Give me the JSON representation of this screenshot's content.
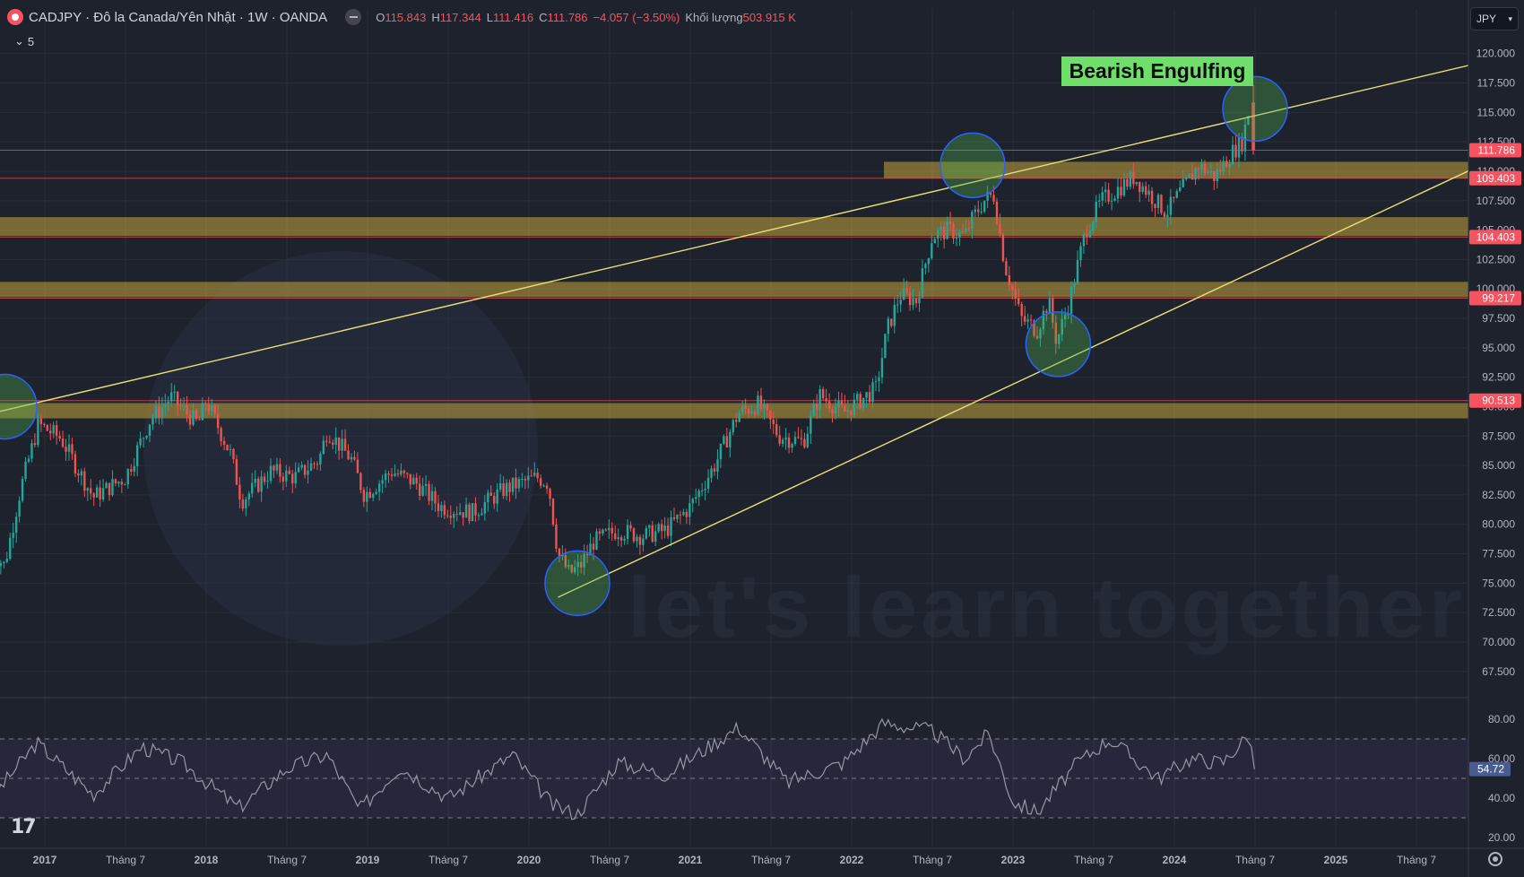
{
  "header": {
    "symbol": "CADJPY · Đô la Canada/Yên Nhật · 1W · OANDA",
    "ohlc": [
      {
        "k": "O",
        "v": "115.843"
      },
      {
        "k": "H",
        "v": "117.344"
      },
      {
        "k": "L",
        "v": "111.416"
      },
      {
        "k": "C",
        "v": "111.786"
      },
      {
        "k": "",
        "v": "−4.057 (−3.50%)"
      },
      {
        "k": "Khối lượng",
        "v": "503.915 K"
      }
    ]
  },
  "collapse_label": "5",
  "currency_button": "JPY",
  "tv_logo": "17",
  "colors": {
    "background": "#1e222d",
    "up": "#26a69a",
    "down": "#ef5350",
    "zone": "#c2a43d",
    "trendline": "#e8e17a",
    "annotation": "#6ee06a",
    "circle_fill": "#4caf50",
    "circle_stroke": "#2962ff",
    "price_label": "#f7525f",
    "rsi_label": "#4a5b8f",
    "rsi_line": "#9598a1"
  },
  "chart_data": {
    "type": "candlestick",
    "timeframe": "1W",
    "watermark": "let's learn together",
    "y_axis": {
      "range": [
        65.5,
        121.5
      ],
      "ticks": [
        "120.000",
        "117.500",
        "115.000",
        "112.500",
        "110.000",
        "107.500",
        "105.000",
        "102.500",
        "100.000",
        "97.500",
        "95.000",
        "92.500",
        "90.000",
        "87.500",
        "85.000",
        "82.500",
        "80.000",
        "77.500",
        "75.000",
        "72.500",
        "70.000",
        "67.500"
      ]
    },
    "x_axis": {
      "labels": [
        "2017",
        "Tháng 7",
        "2018",
        "Tháng 7",
        "2019",
        "Tháng 7",
        "2020",
        "Tháng 7",
        "2021",
        "Tháng 7",
        "2022",
        "Tháng 7",
        "2023",
        "Tháng 7",
        "2024",
        "Tháng 7",
        "2025",
        "Tháng 7"
      ],
      "bold": [
        true,
        false,
        true,
        false,
        true,
        false,
        true,
        false,
        true,
        false,
        true,
        false,
        true,
        false,
        true,
        false,
        true,
        false
      ]
    },
    "anchors": [
      {
        "t": 2016.65,
        "p": 78.0
      },
      {
        "t": 2016.75,
        "p": 76.5
      },
      {
        "t": 2016.85,
        "p": 83.0
      },
      {
        "t": 2016.96,
        "p": 88.5
      },
      {
        "t": 2017.1,
        "p": 87.3
      },
      {
        "t": 2017.3,
        "p": 82.3
      },
      {
        "t": 2017.5,
        "p": 84.0
      },
      {
        "t": 2017.65,
        "p": 88.8
      },
      {
        "t": 2017.78,
        "p": 90.8
      },
      {
        "t": 2017.95,
        "p": 88.5
      },
      {
        "t": 2018.0,
        "p": 90.5
      },
      {
        "t": 2018.15,
        "p": 86.0
      },
      {
        "t": 2018.22,
        "p": 82.0
      },
      {
        "t": 2018.4,
        "p": 84.5
      },
      {
        "t": 2018.55,
        "p": 84.0
      },
      {
        "t": 2018.7,
        "p": 85.5
      },
      {
        "t": 2018.75,
        "p": 88.0
      },
      {
        "t": 2018.9,
        "p": 85.5
      },
      {
        "t": 2018.98,
        "p": 82.5
      },
      {
        "t": 2019.15,
        "p": 84.5
      },
      {
        "t": 2019.3,
        "p": 83.5
      },
      {
        "t": 2019.45,
        "p": 81.5
      },
      {
        "t": 2019.65,
        "p": 81.0
      },
      {
        "t": 2019.85,
        "p": 83.0
      },
      {
        "t": 2020.05,
        "p": 84.0
      },
      {
        "t": 2020.12,
        "p": 83.5
      },
      {
        "t": 2020.18,
        "p": 77.5
      },
      {
        "t": 2020.25,
        "p": 75.8
      },
      {
        "t": 2020.32,
        "p": 76.5
      },
      {
        "t": 2020.4,
        "p": 78.5
      },
      {
        "t": 2020.55,
        "p": 79.5
      },
      {
        "t": 2020.7,
        "p": 79.0
      },
      {
        "t": 2020.85,
        "p": 79.5
      },
      {
        "t": 2021.0,
        "p": 81.5
      },
      {
        "t": 2021.15,
        "p": 85.0
      },
      {
        "t": 2021.3,
        "p": 89.5
      },
      {
        "t": 2021.42,
        "p": 90.2
      },
      {
        "t": 2021.55,
        "p": 87.5
      },
      {
        "t": 2021.7,
        "p": 87.0
      },
      {
        "t": 2021.8,
        "p": 91.0
      },
      {
        "t": 2021.95,
        "p": 89.5
      },
      {
        "t": 2022.05,
        "p": 90.5
      },
      {
        "t": 2022.15,
        "p": 91.5
      },
      {
        "t": 2022.22,
        "p": 96.5
      },
      {
        "t": 2022.3,
        "p": 99.5
      },
      {
        "t": 2022.4,
        "p": 99.0
      },
      {
        "t": 2022.5,
        "p": 104.5
      },
      {
        "t": 2022.6,
        "p": 105.0
      },
      {
        "t": 2022.7,
        "p": 104.5
      },
      {
        "t": 2022.75,
        "p": 106.0
      },
      {
        "t": 2022.82,
        "p": 107.5
      },
      {
        "t": 2022.88,
        "p": 108.0
      },
      {
        "t": 2022.95,
        "p": 102.0
      },
      {
        "t": 2023.05,
        "p": 97.5
      },
      {
        "t": 2023.15,
        "p": 96.5
      },
      {
        "t": 2023.22,
        "p": 99.0
      },
      {
        "t": 2023.27,
        "p": 95.5
      },
      {
        "t": 2023.35,
        "p": 99.0
      },
      {
        "t": 2023.45,
        "p": 105.0
      },
      {
        "t": 2023.55,
        "p": 107.5
      },
      {
        "t": 2023.65,
        "p": 108.5
      },
      {
        "t": 2023.75,
        "p": 109.5
      },
      {
        "t": 2023.85,
        "p": 108.0
      },
      {
        "t": 2023.95,
        "p": 106.5
      },
      {
        "t": 2024.05,
        "p": 108.5
      },
      {
        "t": 2024.15,
        "p": 110.5
      },
      {
        "t": 2024.25,
        "p": 109.5
      },
      {
        "t": 2024.35,
        "p": 111.5
      },
      {
        "t": 2024.42,
        "p": 112.5
      },
      {
        "t": 2024.47,
        "p": 115.8
      }
    ],
    "last_candle": {
      "open": 115.843,
      "high": 117.344,
      "low": 111.416,
      "close": 111.786
    },
    "zones": [
      {
        "low": 89.0,
        "high": 90.3,
        "from": 2016.6,
        "to": 2026.15
      },
      {
        "low": 99.3,
        "high": 100.6,
        "from": 2016.6,
        "to": 2026.0
      },
      {
        "low": 104.5,
        "high": 106.1,
        "from": 2016.6,
        "to": 2026.0
      },
      {
        "low": 109.4,
        "high": 110.8,
        "from": 2022.2,
        "to": 2025.95
      }
    ],
    "lines": [
      {
        "name": "upper-trendline",
        "points": [
          [
            2016.6,
            89.2
          ],
          [
            2025.95,
            119.4
          ]
        ]
      },
      {
        "name": "lower-trendline",
        "points": [
          [
            2020.18,
            73.8
          ],
          [
            2025.85,
            110.2
          ]
        ]
      }
    ],
    "circles": [
      {
        "t": 2016.75,
        "p": 90.0
      },
      {
        "t": 2020.3,
        "p": 75.0
      },
      {
        "t": 2022.75,
        "p": 110.5
      },
      {
        "t": 2023.28,
        "p": 95.3
      },
      {
        "t": 2024.5,
        "p": 115.3
      }
    ],
    "price_labels": [
      {
        "value": "111.786",
        "p": 111.786
      },
      {
        "value": "109.403",
        "p": 109.403
      },
      {
        "value": "104.403",
        "p": 104.403
      },
      {
        "value": "99.217",
        "p": 99.217
      },
      {
        "value": "90.513",
        "p": 90.513
      }
    ],
    "annotations": [
      "Bearish Engulfing"
    ],
    "rsi": {
      "range": [
        15,
        90
      ],
      "ticks": [
        "80.00",
        "60.00",
        "40.00",
        "20.00"
      ],
      "band": [
        30,
        70
      ],
      "mid": 50,
      "last": "54.72",
      "anchors": [
        {
          "t": 2016.65,
          "v": 38
        },
        {
          "t": 2016.95,
          "v": 68
        },
        {
          "t": 2017.3,
          "v": 42
        },
        {
          "t": 2017.6,
          "v": 66
        },
        {
          "t": 2017.85,
          "v": 58
        },
        {
          "t": 2018.2,
          "v": 35
        },
        {
          "t": 2018.5,
          "v": 55
        },
        {
          "t": 2018.75,
          "v": 62
        },
        {
          "t": 2018.95,
          "v": 34
        },
        {
          "t": 2019.2,
          "v": 56
        },
        {
          "t": 2019.5,
          "v": 40
        },
        {
          "t": 2019.9,
          "v": 62
        },
        {
          "t": 2020.15,
          "v": 36
        },
        {
          "t": 2020.3,
          "v": 32
        },
        {
          "t": 2020.55,
          "v": 58
        },
        {
          "t": 2020.85,
          "v": 52
        },
        {
          "t": 2021.3,
          "v": 76
        },
        {
          "t": 2021.6,
          "v": 48
        },
        {
          "t": 2021.95,
          "v": 58
        },
        {
          "t": 2022.2,
          "v": 78
        },
        {
          "t": 2022.5,
          "v": 74
        },
        {
          "t": 2022.7,
          "v": 60
        },
        {
          "t": 2022.85,
          "v": 73
        },
        {
          "t": 2023.0,
          "v": 38
        },
        {
          "t": 2023.15,
          "v": 33
        },
        {
          "t": 2023.4,
          "v": 58
        },
        {
          "t": 2023.6,
          "v": 70
        },
        {
          "t": 2023.9,
          "v": 50
        },
        {
          "t": 2024.1,
          "v": 60
        },
        {
          "t": 2024.3,
          "v": 58
        },
        {
          "t": 2024.46,
          "v": 72
        },
        {
          "t": 2024.5,
          "v": 54.72
        }
      ]
    }
  }
}
